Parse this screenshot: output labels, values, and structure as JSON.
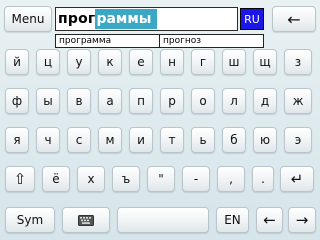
{
  "top": {
    "menu_label": "Menu",
    "typed_text": "прог",
    "completion_text": "раммы",
    "language_label": "RU",
    "backspace_glyph": "←",
    "accent_color": "#3aa7c4",
    "language_color": "#1a17e8"
  },
  "suggestions": [
    "программа",
    "прогноз"
  ],
  "rows": [
    [
      "й",
      "ц",
      "у",
      "к",
      "е",
      "н",
      "г",
      "ш",
      "щ",
      "з"
    ],
    [
      "ф",
      "ы",
      "в",
      "а",
      "п",
      "р",
      "о",
      "л",
      "д",
      "ж"
    ],
    [
      "я",
      "ч",
      "с",
      "м",
      "и",
      "т",
      "ь",
      "б",
      "ю",
      "э"
    ],
    [
      "⇧",
      "ё",
      "х",
      "ъ",
      "\"",
      "-",
      ",",
      ".",
      "↵"
    ]
  ],
  "bottom": {
    "sym_label": "Sym",
    "keyboard_icon": "keyboard-icon",
    "lang_switch_label": "EN",
    "left_arrow": "←",
    "right_arrow": "→"
  }
}
